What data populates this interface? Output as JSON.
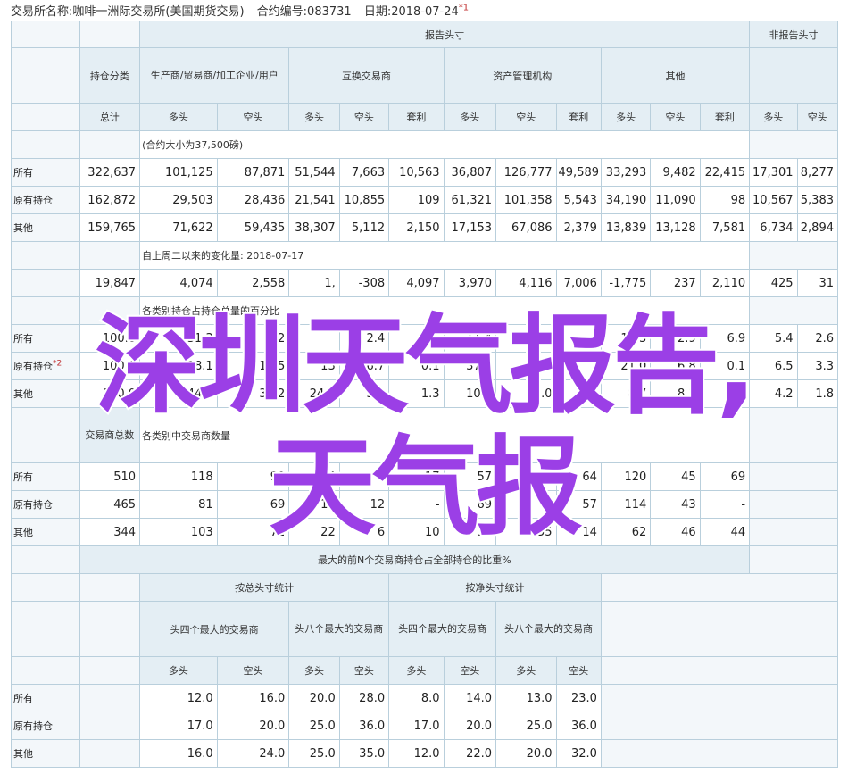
{
  "header": {
    "exchange": "交易所名称:咖啡一洲际交易所(美国期货交易)",
    "contract": "合约编号:083731",
    "date": "日期:2018-07-24",
    "note_mark": "*1"
  },
  "sec1": {
    "report_header": "报告头寸",
    "nonreport_header": "非报告头寸",
    "holding_class": "持仓分类",
    "producer": "生产商/贸易商/加工企业/用户",
    "swap": "互换交易商",
    "money": "资产管理机构",
    "other": "其他",
    "total": "总计",
    "long": "多头",
    "short": "空头",
    "spread": "套利",
    "note": "(合约大小为37,500磅)",
    "rows": [
      {
        "label": "所有",
        "values": [
          "322,637",
          "101,125",
          "87,871",
          "51,544",
          "7,663",
          "10,563",
          "36,807",
          "126,777",
          "49,589",
          "33,293",
          "9,482",
          "22,415",
          "17,301",
          "8,277"
        ]
      },
      {
        "label": "原有持仓",
        "values": [
          "162,872",
          "29,503",
          "28,436",
          "21,541",
          "10,855",
          "109",
          "61,321",
          "101,358",
          "5,543",
          "34,190",
          "11,090",
          "98",
          "10,567",
          "5,383"
        ]
      },
      {
        "label": "其他",
        "values": [
          "159,765",
          "71,622",
          "59,435",
          "38,307",
          "5,112",
          "2,150",
          "17,153",
          "67,086",
          "2,379",
          "13,839",
          "13,128",
          "7,581",
          "6,734",
          "2,894"
        ]
      }
    ]
  },
  "sec2": {
    "note": "自上周二以来的变化量: 2018-07-17",
    "values": [
      "19,847",
      "4,074",
      "2,558",
      "1,",
      "-308",
      "4,097",
      "3,970",
      "",
      "4,116",
      "7,006",
      "-1,775",
      "237",
      "2,110",
      "425",
      "31"
    ]
  },
  "sec3": {
    "note": "各类别持仓占持仓总量的百分比",
    "rows": [
      {
        "label": "所有",
        "values": [
          "100.0",
          "31.3",
          "2",
          "",
          "2.4",
          "",
          "11.4",
          "39",
          "",
          "10.3",
          "2.9",
          "6.9",
          "5.4",
          "2.6"
        ]
      },
      {
        "label": "原有持仓",
        "mark": "*2",
        "values": [
          "100.0",
          "18.1",
          "17.5",
          "13",
          "6.7",
          "0.1",
          "37.6",
          "62.2",
          "",
          "21.0",
          "6.8",
          "0.1",
          "6.5",
          "3.3"
        ]
      },
      {
        "label": "其他",
        "values": [
          "100.0",
          "44.8",
          "37.2",
          "24.0",
          "3.2",
          "1.3",
          "10.7",
          "42.0",
          "",
          "8.7",
          "8.2",
          "4.7",
          "4.2",
          "1.8"
        ]
      }
    ]
  },
  "sec4": {
    "trader_total": "交易商总数",
    "note": "各类别中交易商数量",
    "rows": [
      {
        "label": "所有",
        "values": [
          "510",
          "118",
          "90",
          "24",
          "7",
          "17",
          "57",
          "",
          "64",
          "120",
          "45",
          "69"
        ]
      },
      {
        "label": "原有持仓",
        "values": [
          "465",
          "81",
          "69",
          "17",
          "12",
          "-",
          "69",
          "",
          "57",
          "114",
          "43",
          "-"
        ]
      },
      {
        "label": "其他",
        "values": [
          "344",
          "103",
          "72",
          "22",
          "6",
          "10",
          "32",
          "55",
          "14",
          "62",
          "46",
          "44"
        ]
      }
    ]
  },
  "sec5": {
    "title": "最大的前N个交易商持仓占全部持仓的比重%",
    "gross": "按总头寸统计",
    "net": "按净头寸统计",
    "top4": "头四个最大的交易商",
    "top8": "头八个最大的交易商",
    "long": "多头",
    "short": "空头",
    "rows": [
      {
        "label": "所有",
        "values": [
          "12.0",
          "16.0",
          "20.0",
          "28.0",
          "8.0",
          "14.0",
          "13.0",
          "23.0"
        ]
      },
      {
        "label": "原有持仓",
        "values": [
          "17.0",
          "20.0",
          "25.0",
          "36.0",
          "17.0",
          "20.0",
          "25.0",
          "36.0"
        ]
      },
      {
        "label": "其他",
        "values": [
          "16.0",
          "24.0",
          "25.0",
          "35.0",
          "12.0",
          "22.0",
          "20.0",
          "32.0"
        ]
      }
    ]
  },
  "watermark": {
    "line1": "深圳天气报告,",
    "line2": "天气报",
    "color": "#9b3fe6"
  }
}
